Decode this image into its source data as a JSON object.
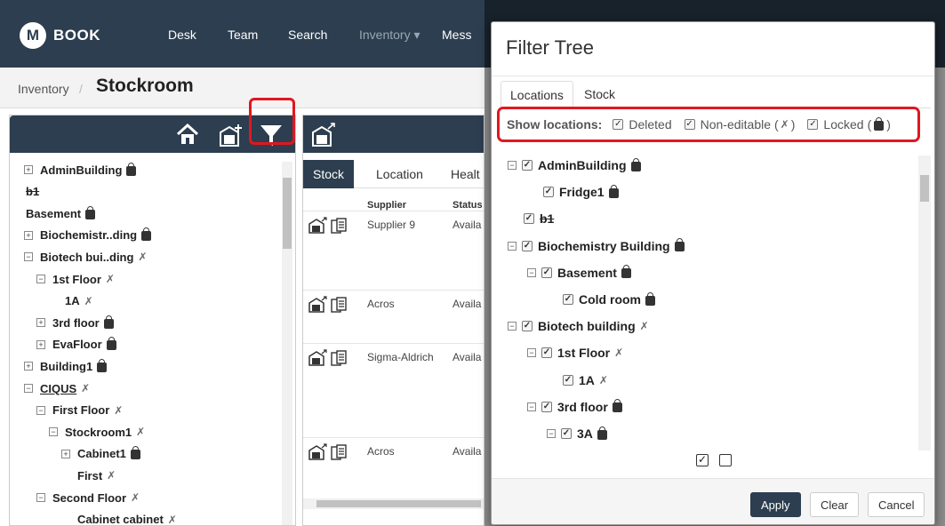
{
  "navbar": {
    "brand": "BOOK",
    "brand_logo": "M",
    "items": [
      "Desk",
      "Team",
      "Search",
      "Inventory ▾",
      "Mess"
    ]
  },
  "breadcrumb": {
    "parent": "Inventory",
    "separator": "/",
    "title": "Stockroom"
  },
  "left_tree": [
    {
      "label": "AdminBuilding",
      "expander": "+",
      "badge": "lock",
      "indent": 0
    },
    {
      "label": "b1",
      "expander": "",
      "badge": "",
      "indent": 0,
      "strike": true
    },
    {
      "label": "Basement",
      "expander": "",
      "badge": "lock",
      "indent": 0
    },
    {
      "label": "Biochemistr..ding",
      "expander": "+",
      "badge": "lock",
      "indent": 0
    },
    {
      "label": "Biotech bui..ding",
      "expander": "−",
      "badge": "noedit",
      "indent": 0
    },
    {
      "label": "1st Floor",
      "expander": "−",
      "badge": "noedit",
      "indent": 1
    },
    {
      "label": "1A",
      "expander": "",
      "badge": "noedit",
      "indent": 2
    },
    {
      "label": "3rd floor",
      "expander": "+",
      "badge": "lock",
      "indent": 1
    },
    {
      "label": "EvaFloor",
      "expander": "+",
      "badge": "lock",
      "indent": 1
    },
    {
      "label": "Building1",
      "expander": "+",
      "badge": "lock",
      "indent": 0
    },
    {
      "label": "CIQUS",
      "expander": "−",
      "badge": "noedit",
      "indent": 0,
      "underline": true
    },
    {
      "label": "First Floor",
      "expander": "−",
      "badge": "noedit",
      "indent": 1
    },
    {
      "label": "Stockroom1",
      "expander": "−",
      "badge": "noedit",
      "indent": 2
    },
    {
      "label": "Cabinet1",
      "expander": "+",
      "badge": "lock",
      "indent": 3
    },
    {
      "label": "First",
      "expander": "",
      "badge": "noedit",
      "indent": 3
    },
    {
      "label": "Second Floor",
      "expander": "−",
      "badge": "noedit",
      "indent": 1
    },
    {
      "label": "Cabinet cabinet",
      "expander": "",
      "badge": "noedit",
      "indent": 3
    }
  ],
  "middle": {
    "tabs": [
      "Stock",
      "Location",
      "Healt"
    ],
    "col_supplier": "Supplier",
    "col_status": "Status",
    "rows": [
      {
        "supplier": "Supplier 9",
        "status": "Availa"
      },
      {
        "supplier": "Acros",
        "status": "Availa"
      },
      {
        "supplier": "Sigma-Aldrich",
        "status": "Availa"
      },
      {
        "supplier": "Acros",
        "status": "Availa"
      }
    ]
  },
  "modal": {
    "title": "Filter Tree",
    "tabs": [
      "Locations",
      "Stock"
    ],
    "show_label": "Show locations:",
    "options": [
      {
        "label": "Deleted",
        "checked": true,
        "icon": ""
      },
      {
        "label": "Non-editable",
        "checked": true,
        "icon": "noedit"
      },
      {
        "label": "Locked",
        "checked": true,
        "icon": "lock"
      }
    ],
    "tree": [
      {
        "label": "AdminBuilding",
        "expander": "−",
        "badge": "lock",
        "indent": 0
      },
      {
        "label": "Fridge1",
        "expander": "",
        "badge": "lock",
        "indent": 1
      },
      {
        "label": "b1",
        "expander": "",
        "badge": "",
        "indent": 0,
        "strike": true
      },
      {
        "label": "Biochemistry Building",
        "expander": "−",
        "badge": "lock",
        "indent": 0
      },
      {
        "label": "Basement",
        "expander": "−",
        "badge": "lock",
        "indent": 1
      },
      {
        "label": "Cold room",
        "expander": "",
        "badge": "lock",
        "indent": 2
      },
      {
        "label": "Biotech building",
        "expander": "−",
        "badge": "noedit",
        "indent": 0
      },
      {
        "label": "1st Floor",
        "expander": "−",
        "badge": "noedit",
        "indent": 1
      },
      {
        "label": "1A",
        "expander": "",
        "badge": "noedit",
        "indent": 2
      },
      {
        "label": "3rd floor",
        "expander": "−",
        "badge": "lock",
        "indent": 1
      },
      {
        "label": "3A",
        "expander": "−",
        "badge": "lock",
        "indent": 2
      }
    ],
    "buttons": {
      "apply": "Apply",
      "clear": "Clear",
      "cancel": "Cancel"
    }
  },
  "colors": {
    "navbar": "#2c3e4f",
    "highlight": "#e0171f",
    "primary_button": "#2c3e4f"
  },
  "icons": [
    "home-icon",
    "add-storage-icon",
    "filter-icon",
    "move-storage-icon",
    "lock-icon",
    "non-editable-icon",
    "select-all-icon",
    "deselect-all-icon"
  ]
}
